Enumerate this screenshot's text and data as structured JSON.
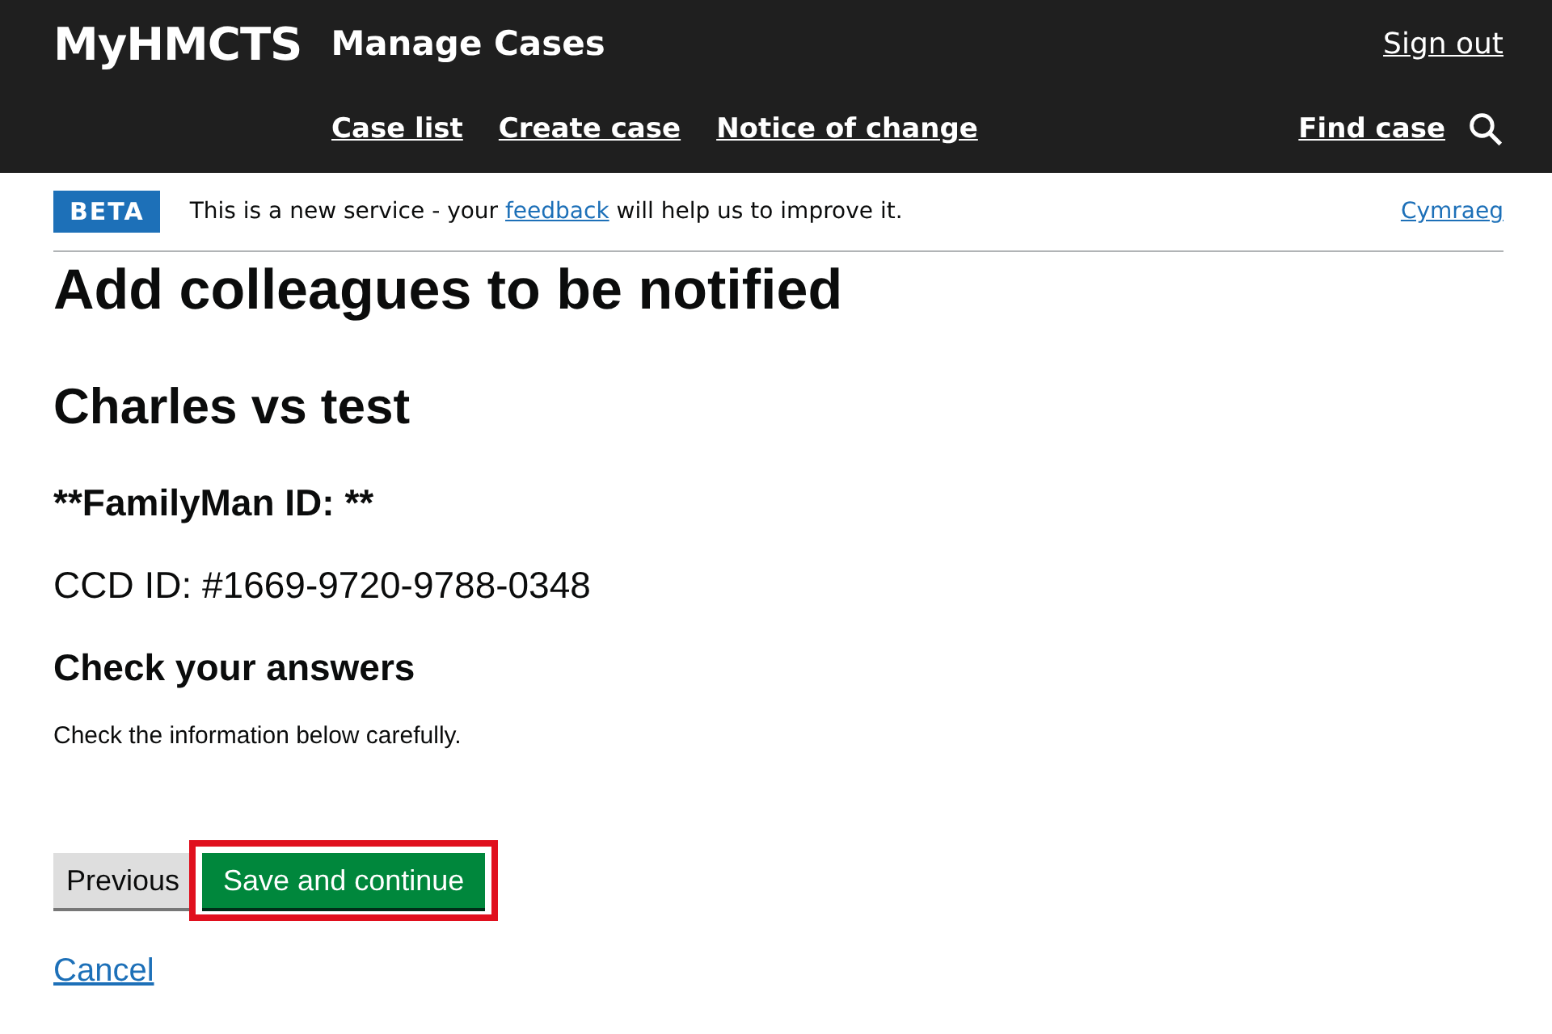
{
  "header": {
    "logo": "MyHMCTS",
    "service": "Manage Cases",
    "sign_out": "Sign out",
    "nav": [
      {
        "label": "Case list"
      },
      {
        "label": "Create case"
      },
      {
        "label": "Notice of change"
      }
    ],
    "find_case": "Find case"
  },
  "phase_banner": {
    "tag": "BETA",
    "text_before": "This is a new service - your",
    "link": "feedback",
    "text_after": "will help us to improve it.",
    "language": "Cymraeg"
  },
  "page": {
    "title": "Add colleagues to be notified",
    "case_name": "Charles vs test",
    "familyman": "**FamilyMan ID: **",
    "ccd_id": "CCD ID: #1669-9720-9788-0348",
    "section": "Check your answers",
    "hint": "Check the information below carefully."
  },
  "buttons": [
    {
      "label": "Previous",
      "kind": "secondary",
      "highlighted": false
    },
    {
      "label": "Save and continue",
      "kind": "primary",
      "highlighted": true
    }
  ],
  "cancel": "Cancel"
}
